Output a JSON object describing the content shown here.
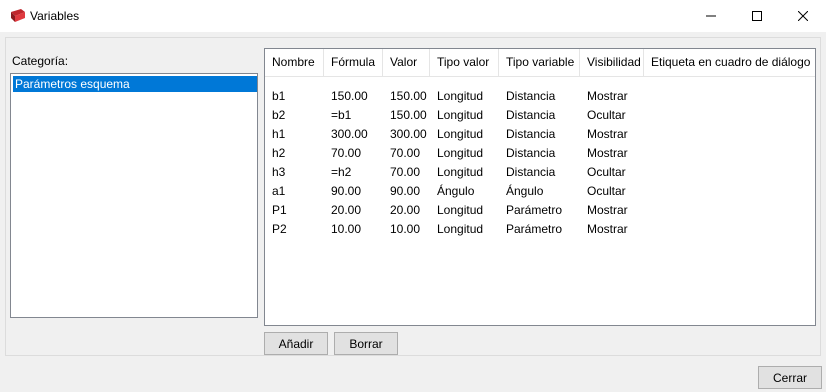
{
  "window": {
    "title": "Variables",
    "minimize_glyph": "—",
    "maximize_glyph": "☐",
    "close_glyph": "✕"
  },
  "category": {
    "label": "Categoría:",
    "items": [
      {
        "label": "Parámetros esquema",
        "selected": true
      }
    ]
  },
  "grid": {
    "columns": [
      "Nombre",
      "Fórmula",
      "Valor",
      "Tipo valor",
      "Tipo variable",
      "Visibilidad",
      "Etiqueta en cuadro de diálogo"
    ],
    "rows": [
      [
        "b1",
        "150.00",
        "150.00",
        "Longitud",
        "Distancia",
        "Mostrar",
        ""
      ],
      [
        "b2",
        "=b1",
        "150.00",
        "Longitud",
        "Distancia",
        "Ocultar",
        ""
      ],
      [
        "h1",
        "300.00",
        "300.00",
        "Longitud",
        "Distancia",
        "Mostrar",
        ""
      ],
      [
        "h2",
        "70.00",
        "70.00",
        "Longitud",
        "Distancia",
        "Mostrar",
        ""
      ],
      [
        "h3",
        "=h2",
        "70.00",
        "Longitud",
        "Distancia",
        "Ocultar",
        ""
      ],
      [
        "a1",
        "90.00",
        "90.00",
        "Ángulo",
        "Ángulo",
        "Ocultar",
        ""
      ],
      [
        "P1",
        "20.00",
        "20.00",
        "Longitud",
        "Parámetro",
        "Mostrar",
        ""
      ],
      [
        "P2",
        "10.00",
        "10.00",
        "Longitud",
        "Parámetro",
        "Mostrar",
        ""
      ]
    ]
  },
  "buttons": {
    "add": "Añadir",
    "delete": "Borrar",
    "close": "Cerrar"
  }
}
